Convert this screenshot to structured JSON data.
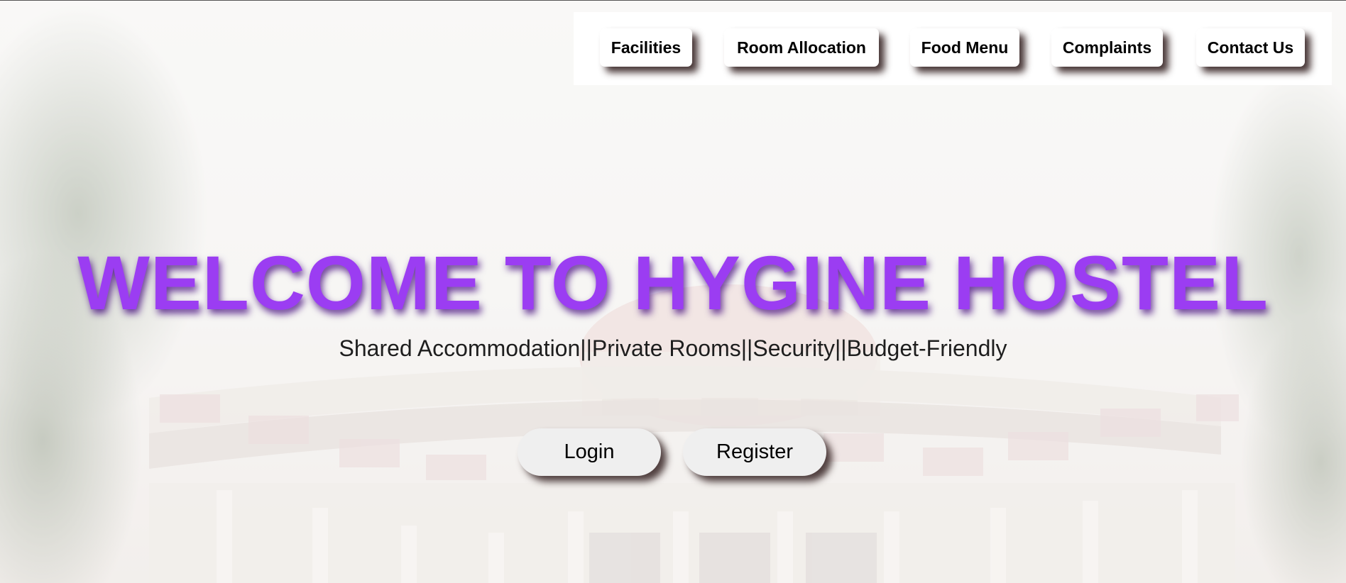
{
  "nav": {
    "items": [
      {
        "label": "Facilities"
      },
      {
        "label": "Room Allocation"
      },
      {
        "label": "Food Menu"
      },
      {
        "label": "Complaints"
      },
      {
        "label": "Contact Us"
      }
    ]
  },
  "hero": {
    "title": "WELCOME TO HYGINE HOSTEL",
    "subtitle": "Shared Accommodation||Private Rooms||Security||Budget-Friendly",
    "title_color": "#9b3df2",
    "login_label": "Login",
    "register_label": "Register"
  }
}
